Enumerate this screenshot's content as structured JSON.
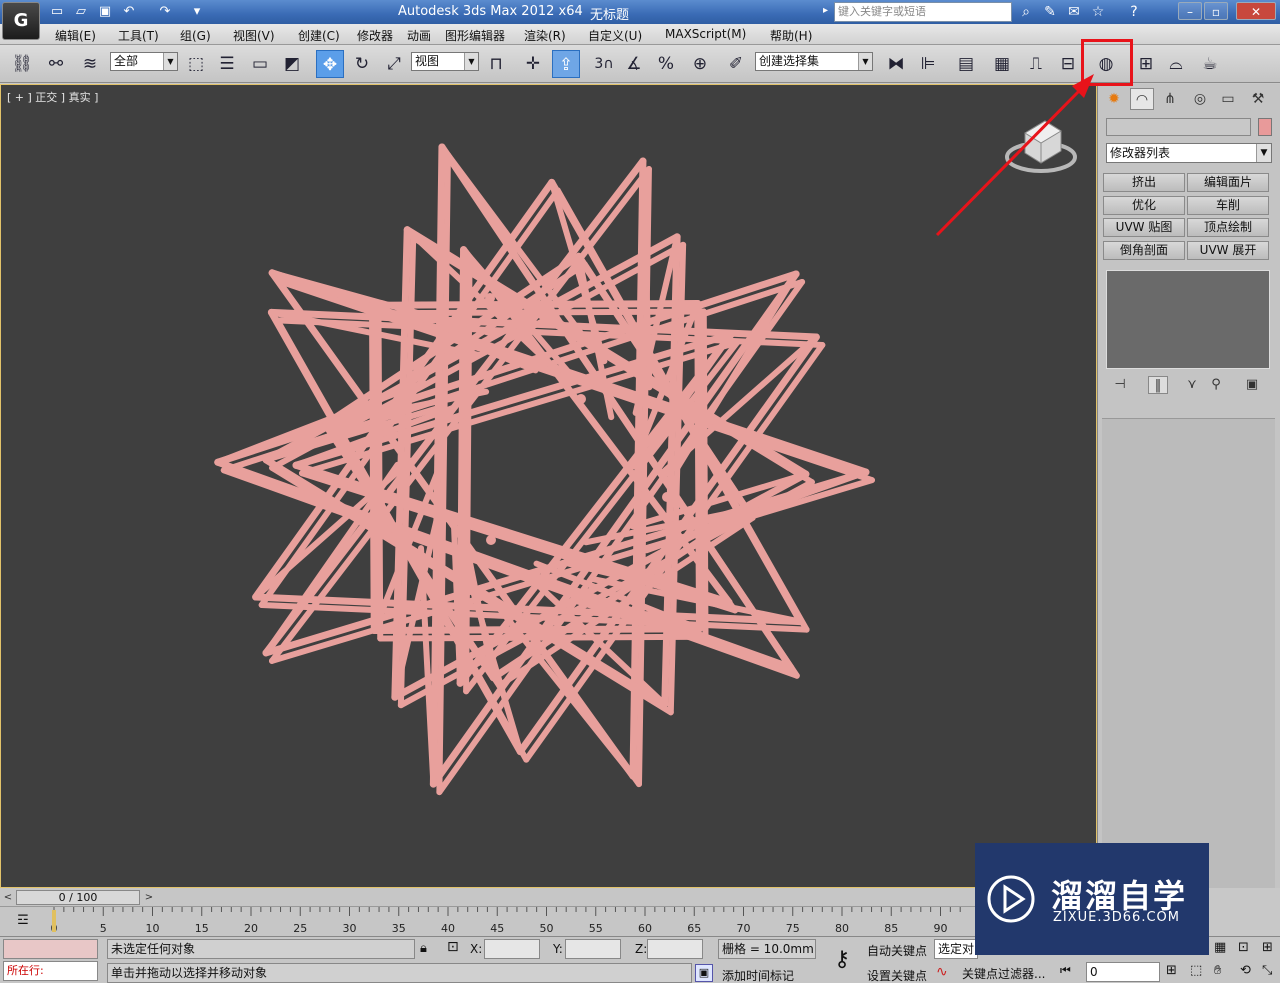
{
  "app": {
    "title": "Autodesk 3ds Max  2012 x64",
    "file": "无标题",
    "logo": "G"
  },
  "search": {
    "placeholder": "键入关键字或短语"
  },
  "menu": [
    "编辑(E)",
    "工具(T)",
    "组(G)",
    "视图(V)",
    "创建(C)",
    "修改器",
    "动画",
    "图形编辑器",
    "渲染(R)",
    "自定义(U)",
    "MAXScript(M)",
    "帮助(H)"
  ],
  "toolbar": {
    "filter": "全部",
    "refcoord": "视图",
    "selset": "创建选择集",
    "snap_label": "3"
  },
  "viewport": {
    "label": "[ + ] 正交 ] 真实 ]",
    "object_color": "#e8a09c",
    "bg_color": "#3f3f3f"
  },
  "command_panel": {
    "modifier_list": "修改器列表",
    "buttons": [
      "挤出",
      "编辑面片",
      "优化",
      "车削",
      "UVW 贴图",
      "顶点绘制",
      "倒角剖面",
      "UVW 展开"
    ]
  },
  "timeline": {
    "frame": "0 / 100",
    "ticks": [
      "0",
      "5",
      "10",
      "15",
      "20",
      "25",
      "30",
      "35",
      "40",
      "45",
      "50",
      "55",
      "60",
      "65",
      "70",
      "75",
      "80",
      "85",
      "90"
    ]
  },
  "status": {
    "selection": "未选定任何对象",
    "prompt": "单击并拖动以选择并移动对象",
    "running": "所在行:",
    "x_label": "X:",
    "y_label": "Y:",
    "z_label": "Z:",
    "grid": "栅格 = 10.0mm",
    "auto_key": "自动关键点",
    "set_key": "设置关键点",
    "sel_mode": "选定对",
    "key_filters": "关键点过滤器...",
    "add_time_tag": "添加时间标记",
    "current_frame": "0"
  },
  "watermark": {
    "title": "溜溜自学",
    "url": "ZIXUE.3D66.COM"
  }
}
